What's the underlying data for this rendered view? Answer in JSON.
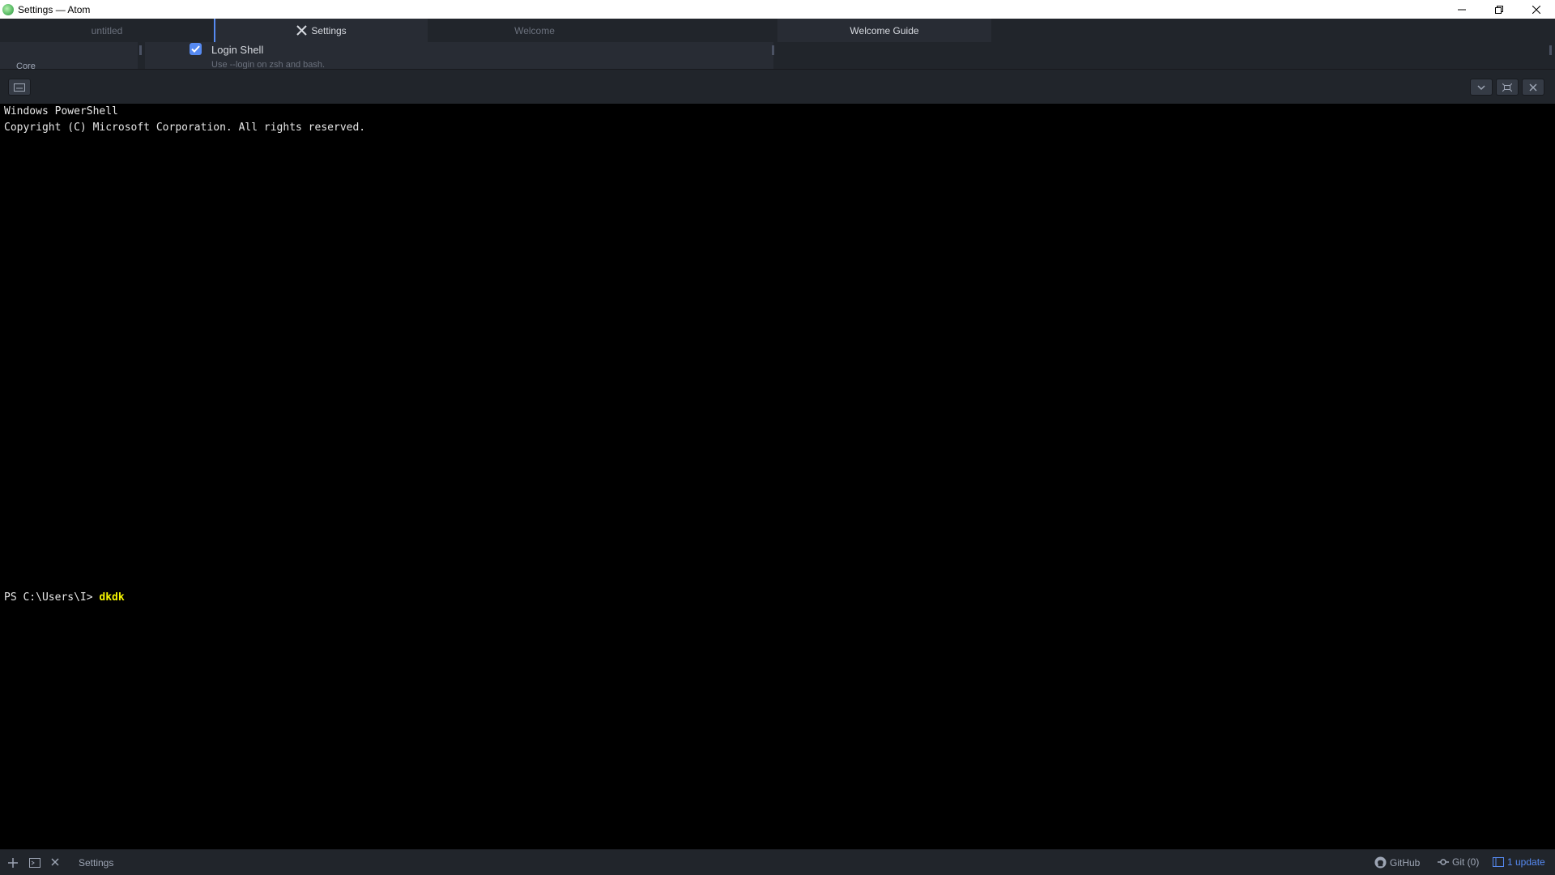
{
  "window": {
    "title": "Settings — Atom"
  },
  "tabs": [
    {
      "label": "untitled"
    },
    {
      "label": "Settings"
    },
    {
      "label": "Welcome"
    },
    {
      "label": ""
    },
    {
      "label": "Welcome Guide"
    }
  ],
  "settings": {
    "nav_item": "Core",
    "option_title": "Login Shell",
    "option_desc": "Use --login on zsh and bash.",
    "option_checked": true
  },
  "terminal": {
    "lines": [
      "Windows PowerShell",
      "Copyright (C) Microsoft Corporation. All rights reserved."
    ],
    "prompt": "PS C:\\Users\\I> ",
    "command": "dkdk"
  },
  "statusbar": {
    "active_tab": "Settings",
    "github": "GitHub",
    "git": "Git (0)",
    "update": "1 update"
  },
  "colors": {
    "accent": "#568af2",
    "command": "#f4f400"
  }
}
